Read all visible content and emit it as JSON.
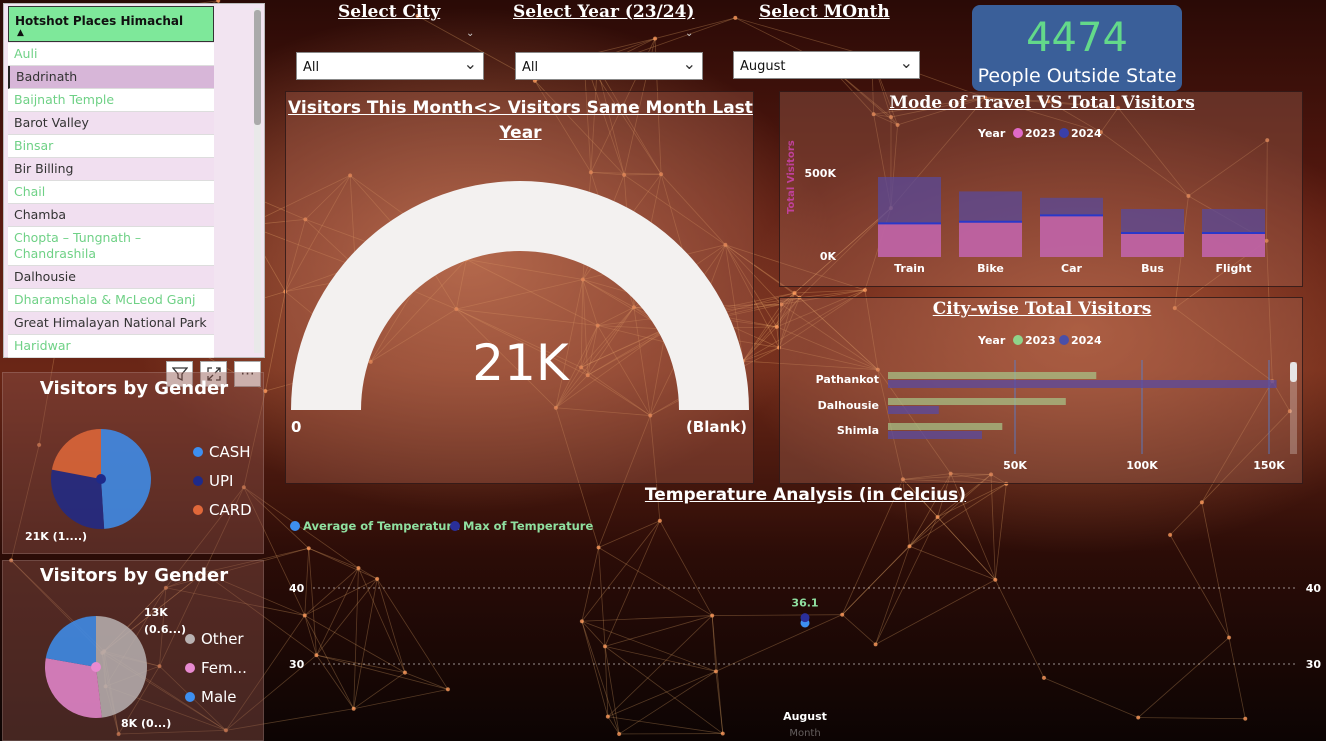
{
  "slicer": {
    "title": "Hotshot Places Himachal",
    "sort_icon": "sort-up-icon",
    "items": [
      {
        "label": "Auli",
        "style": "green",
        "bg": "white"
      },
      {
        "label": "Badrinath",
        "style": "dark",
        "bg": "sel"
      },
      {
        "label": "Baijnath Temple",
        "style": "green",
        "bg": "white"
      },
      {
        "label": "Barot Valley",
        "style": "dark",
        "bg": "lilac"
      },
      {
        "label": "Binsar",
        "style": "green",
        "bg": "white"
      },
      {
        "label": "Bir Billing",
        "style": "dark",
        "bg": "lilac"
      },
      {
        "label": "Chail",
        "style": "green",
        "bg": "white"
      },
      {
        "label": "Chamba",
        "style": "dark",
        "bg": "lilac"
      },
      {
        "label": "Chopta – Tungnath – Chandrashila",
        "style": "green",
        "bg": "white"
      },
      {
        "label": "Dalhousie",
        "style": "dark",
        "bg": "lilac"
      },
      {
        "label": "Dharamshala & McLeod Ganj",
        "style": "green",
        "bg": "white"
      },
      {
        "label": "Great Himalayan National Park",
        "style": "dark",
        "bg": "lilac"
      },
      {
        "label": "Haridwar",
        "style": "green",
        "bg": "white"
      }
    ]
  },
  "visual_tools": {
    "filter_icon": "filter-icon",
    "focus_icon": "focus-mode-icon",
    "more_label": "···"
  },
  "filters": {
    "city": {
      "label": "Select City",
      "value": "All"
    },
    "year": {
      "label": "Select Year (23/24)",
      "value": "All"
    },
    "month": {
      "label": "Select MOnth",
      "value": "August"
    }
  },
  "kpi": {
    "value": "4474",
    "label": "People Outside State"
  },
  "gauge": {
    "title_line1": "Visitors This Month<> Visitors Same Month Last",
    "title_line2": "Year",
    "value_label": "21K",
    "min_label": "0",
    "max_label": "(Blank)",
    "fill_fraction": 1.0
  },
  "payment_panel": {
    "title": "Visitors by Gender",
    "legend": [
      {
        "label": "CASH",
        "color": "#3d8ff0"
      },
      {
        "label": "UPI",
        "color": "#1e2a8a"
      },
      {
        "label": "CARD",
        "color": "#e0683a"
      }
    ],
    "data_label": "21K (1....)"
  },
  "gender_panel": {
    "title": "Visitors by Gender",
    "legend": [
      {
        "label": "Other",
        "color": "#b9b2b2"
      },
      {
        "label": "Fem...",
        "color": "#e88ad0"
      },
      {
        "label": "Male",
        "color": "#3d8ff0"
      }
    ],
    "label_top_1": "13K",
    "label_top_2": "(0.6...)",
    "label_bottom": "8K (0...)"
  },
  "chart_data": [
    {
      "type": "pie",
      "title": "Visitors by Gender",
      "slices": [
        {
          "name": "CASH",
          "value": 0.49,
          "color": "#3d8ff0"
        },
        {
          "name": "UPI",
          "value": 0.29,
          "color": "#1e2a8a"
        },
        {
          "name": "CARD",
          "value": 0.22,
          "color": "#e0683a"
        }
      ]
    },
    {
      "type": "pie",
      "title": "Visitors by Gender",
      "slices": [
        {
          "name": "Other",
          "value": 13000,
          "color": "#b9b2b2"
        },
        {
          "name": "Fem...",
          "value": 8000,
          "color": "#e88ad0"
        },
        {
          "name": "Male",
          "value": 6000,
          "color": "#3d8ff0"
        }
      ]
    },
    {
      "type": "bar",
      "title": "Mode of Travel VS Total Visitors",
      "ylabel": "Total Visitors",
      "legend_title": "Year",
      "categories": [
        "Train",
        "Bike",
        "Car",
        "Bus",
        "Flight"
      ],
      "yticks": [
        "500K",
        "0K"
      ],
      "ylim": [
        0,
        500000
      ],
      "series": [
        {
          "name": "2023",
          "color": "#e06ac8",
          "values": [
            210000,
            220000,
            260000,
            150000,
            150000
          ]
        },
        {
          "name": "2024",
          "color": "#3a3fa8",
          "values": [
            500000,
            410000,
            370000,
            300000,
            300000
          ]
        }
      ]
    },
    {
      "type": "bar",
      "orientation": "horizontal",
      "title": "City-wise Total Visitors",
      "legend_title": "Year",
      "categories": [
        "Pathankot",
        "Dalhousie",
        "Shimla"
      ],
      "xticks": [
        "50K",
        "100K",
        "150K"
      ],
      "xlim": [
        0,
        160000
      ],
      "series": [
        {
          "name": "2023",
          "color": "#8fd48a",
          "values": [
            82000,
            70000,
            45000
          ]
        },
        {
          "name": "2024",
          "color": "#4a4fa8",
          "values": [
            153000,
            20000,
            37000
          ]
        }
      ]
    },
    {
      "type": "line",
      "title": "Temperature Analysis (in Celcius)",
      "xlabel": "Month",
      "categories": [
        "August"
      ],
      "yticks": [
        "40",
        "30"
      ],
      "series": [
        {
          "name": "Average of Temperature",
          "color": "#3d8ff0",
          "values": [
            35.4
          ]
        },
        {
          "name": "Max of Temperature",
          "color": "#2a2f9a",
          "values": [
            36.1
          ]
        }
      ],
      "data_label": "36.1"
    }
  ]
}
